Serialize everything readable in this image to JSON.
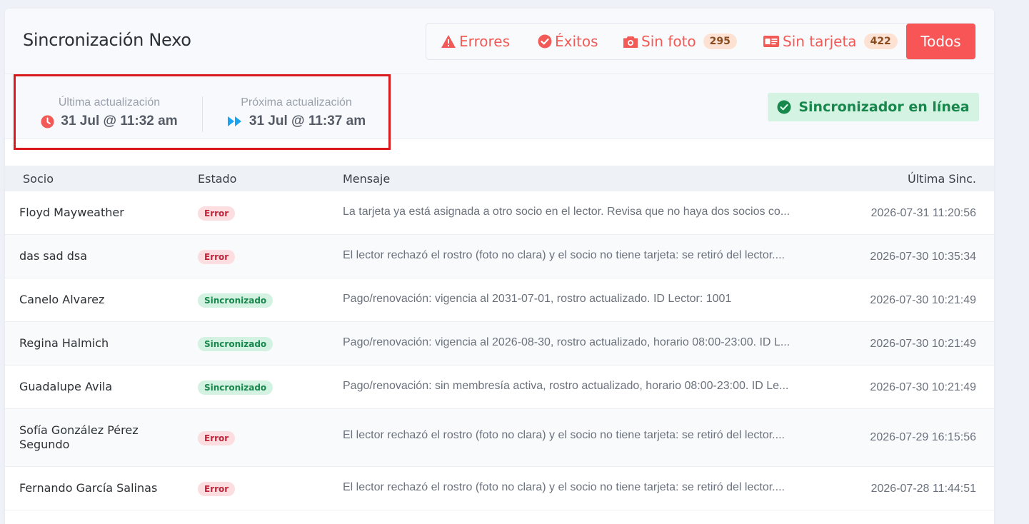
{
  "header": {
    "title": "Sincronización Nexo",
    "filters": [
      {
        "label": "Errores",
        "icon": "warning-icon"
      },
      {
        "label": "Éxitos",
        "icon": "check-circle-icon"
      },
      {
        "label": "Sin foto",
        "icon": "camera-icon",
        "count": "295"
      },
      {
        "label": "Sin tarjeta",
        "icon": "id-card-icon",
        "count": "422"
      }
    ],
    "todos_label": "Todos"
  },
  "status": {
    "last_update_label": "Última actualización",
    "last_update_value": "31 Jul @ 11:32 am",
    "next_update_label": "Próxima actualización",
    "next_update_value": "31 Jul @ 11:37 am",
    "online_label": "Sincronizador en línea"
  },
  "table": {
    "columns": [
      "Socio",
      "Estado",
      "Mensaje",
      "Última Sinc."
    ],
    "rows": [
      {
        "socio": "Floyd Mayweather",
        "estado": "Error",
        "mensaje": "La tarjeta ya está asignada a otro socio en el lector. Revisa que no haya dos socios co...",
        "fecha": "2026-07-31 11:20:56"
      },
      {
        "socio": "das sad dsa",
        "estado": "Error",
        "mensaje": "El lector rechazó el rostro (foto no clara) y el socio no tiene tarjeta: se retiró del lector....",
        "fecha": "2026-07-30 10:35:34"
      },
      {
        "socio": "Canelo Alvarez",
        "estado": "Sincronizado",
        "mensaje": "Pago/renovación: vigencia al 2031-07-01, rostro actualizado. ID Lector: 1001",
        "fecha": "2026-07-30 10:21:49"
      },
      {
        "socio": "Regina Halmich",
        "estado": "Sincronizado",
        "mensaje": "Pago/renovación: vigencia al 2026-08-30, rostro actualizado, horario 08:00-23:00. ID L...",
        "fecha": "2026-07-30 10:21:49"
      },
      {
        "socio": "Guadalupe Avila",
        "estado": "Sincronizado",
        "mensaje": "Pago/renovación: sin membresía activa, rostro actualizado, horario 08:00-23:00. ID Le...",
        "fecha": "2026-07-30 10:21:49"
      },
      {
        "socio": "Sofía González Pérez Segundo",
        "estado": "Error",
        "mensaje": "El lector rechazó el rostro (foto no clara) y el socio no tiene tarjeta: se retiró del lector....",
        "fecha": "2026-07-29 16:15:56"
      },
      {
        "socio": "Fernando García Salinas",
        "estado": "Error",
        "mensaje": "El lector rechazó el rostro (foto no clara) y el socio no tiene tarjeta: se retiró del lector....",
        "fecha": "2026-07-28 11:44:51"
      }
    ]
  },
  "colors": {
    "accent_red": "#f85656",
    "success_green": "#17874c",
    "highlight_border": "#d9191c",
    "next_icon_blue": "#1aa3f0"
  }
}
